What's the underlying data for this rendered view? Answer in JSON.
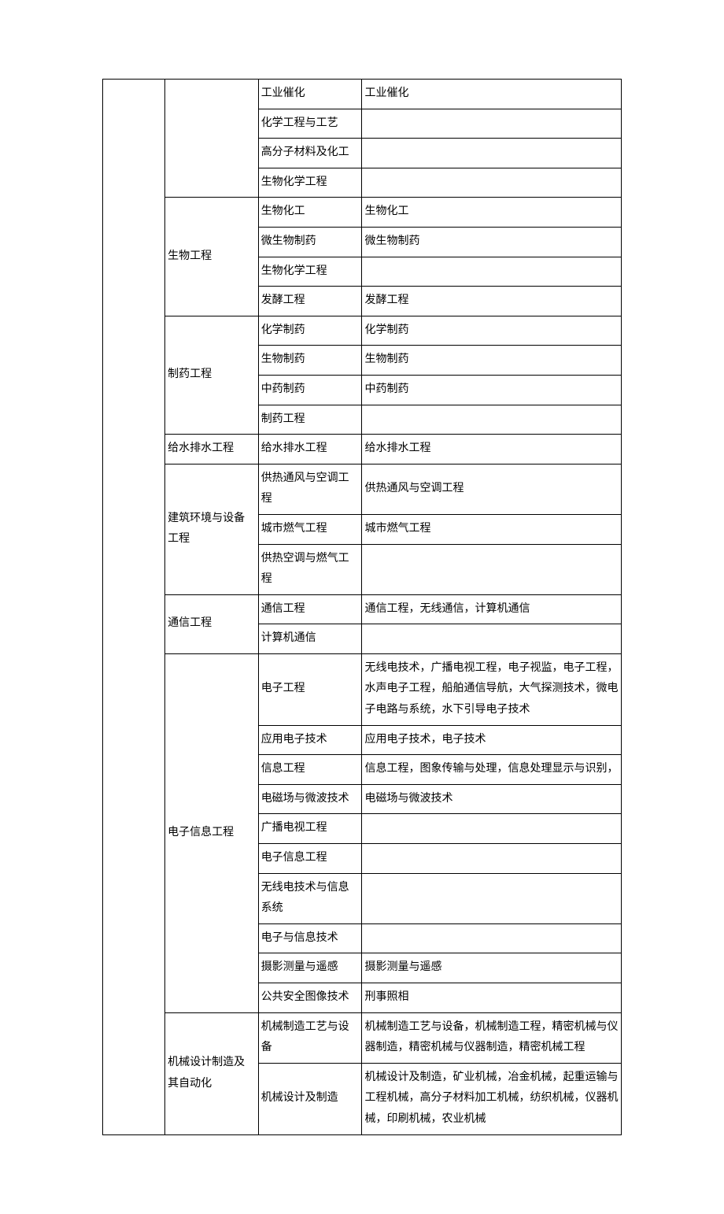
{
  "rows": [
    {
      "c1": "",
      "c2": "",
      "c3": "工业催化",
      "c4": "工业催化",
      "c1span": 34,
      "c2span": 4
    },
    {
      "c3": "化学工程与工艺",
      "c4": ""
    },
    {
      "c3": "高分子材料及化工",
      "c4": ""
    },
    {
      "c3": "生物化学工程",
      "c4": ""
    },
    {
      "c2": "生物工程",
      "c3": "生物化工",
      "c4": "生物化工",
      "c2span": 4
    },
    {
      "c3": "微生物制药",
      "c4": "微生物制药"
    },
    {
      "c3": "生物化学工程",
      "c4": ""
    },
    {
      "c3": "发酵工程",
      "c4": "发酵工程"
    },
    {
      "c2": "制药工程",
      "c3": "化学制药",
      "c4": "化学制药",
      "c2span": 4
    },
    {
      "c3": "生物制药",
      "c4": "生物制药"
    },
    {
      "c3": "中药制药",
      "c4": "中药制药"
    },
    {
      "c3": "制药工程",
      "c4": ""
    },
    {
      "c2": "给水排水工程",
      "c3": "给水排水工程",
      "c4": "给水排水工程",
      "c2span": 1
    },
    {
      "c2": "建筑环境与设备工程",
      "c3": "供热通风与空调工程",
      "c4": "供热通风与空调工程",
      "c2span": 3
    },
    {
      "c3": "城市燃气工程",
      "c4": "城市燃气工程"
    },
    {
      "c3": "供热空调与燃气工程",
      "c4": ""
    },
    {
      "c2": "通信工程",
      "c3": "通信工程",
      "c4": "通信工程，无线通信，计算机通信",
      "c2span": 2
    },
    {
      "c3": "计算机通信",
      "c4": ""
    },
    {
      "c2": "电子信息工程",
      "c3": "电子工程",
      "c4": "无线电技术，广播电视工程，电子视监，电子工程，水声电子工程，船舶通信导航，大气探测技术，微电子电路与系统，水下引导电子技术",
      "c2span": 10
    },
    {
      "c3": "应用电子技术",
      "c4": "应用电子技术，电子技术"
    },
    {
      "c3": "信息工程",
      "c4": "信息工程，图象传输与处理，信息处理显示与识别，"
    },
    {
      "c3": "电磁场与微波技术",
      "c4": "电磁场与微波技术"
    },
    {
      "c3": "广播电视工程",
      "c4": ""
    },
    {
      "c3": "电子信息工程",
      "c4": ""
    },
    {
      "c3": "无线电技术与信息系统",
      "c4": ""
    },
    {
      "c3": "电子与信息技术",
      "c4": ""
    },
    {
      "c3": "摄影测量与遥感",
      "c4": "摄影测量与遥感"
    },
    {
      "c3": "公共安全图像技术",
      "c4": "刑事照相"
    },
    {
      "c2": "机械设计制造及其自动化",
      "c3": "机械制造工艺与设备",
      "c4": "机械制造工艺与设备，机械制造工程，精密机械与仪器制造，精密机械与仪器制造，精密机械工程",
      "c2span": 6
    },
    {
      "c3": "机械设计及制造",
      "c4": "机械设计及制造，矿业机械，冶金机械，起重运输与工程机械，高分子材料加工机械，纺织机械，仪器机械，印刷机械，农业机械"
    }
  ]
}
